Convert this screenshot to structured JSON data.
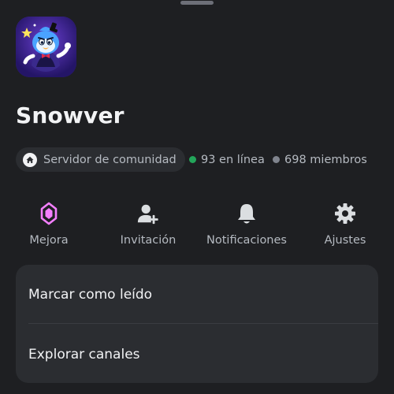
{
  "server": {
    "name": "Snowver",
    "community_label": "Servidor de comunidad",
    "online": "93 en línea",
    "members": "698 miembros"
  },
  "actions": [
    {
      "label": "Mejora",
      "icon": "boost-gem-icon"
    },
    {
      "label": "Invitación",
      "icon": "add-user-icon"
    },
    {
      "label": "Notificaciones",
      "icon": "bell-icon"
    },
    {
      "label": "Ajustes",
      "icon": "gear-icon"
    }
  ],
  "menu": {
    "items": [
      {
        "label": "Marcar como leído"
      },
      {
        "label": "Explorar canales"
      }
    ]
  },
  "colors": {
    "background": "#1e1f22",
    "card": "#2b2d31",
    "online": "#23a55a",
    "offline": "#80848e",
    "boost": "#f47fff"
  }
}
